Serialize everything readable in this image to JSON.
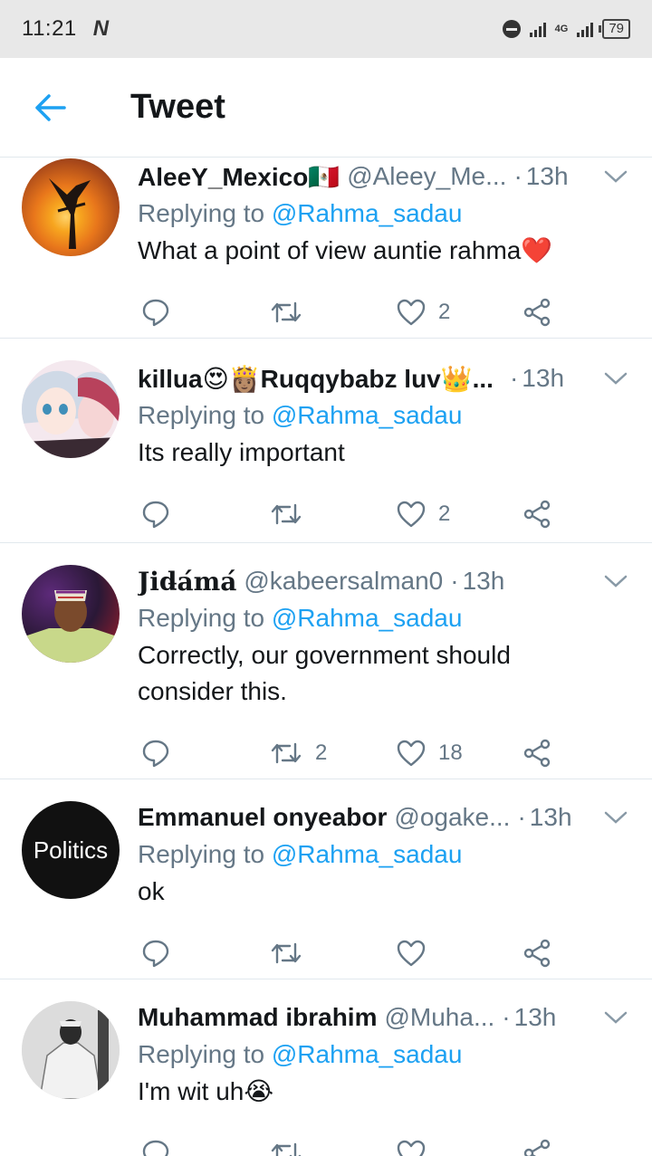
{
  "status_bar": {
    "time": "11:21",
    "carrier_icon": "N",
    "network": "4G",
    "battery": "79"
  },
  "header": {
    "title": "Tweet"
  },
  "tweets": [
    {
      "name": "AleeY_Mexico🇲🇽",
      "handle": "@Aleey_Me...",
      "time": "13h",
      "replying_label": "Replying to",
      "mention": "@Rahma_sadau",
      "text": "What a point of view auntie rahma❤️",
      "retweets": "",
      "likes": "2"
    },
    {
      "name": "killua😍👸🏽Ruqqybabz luv👑...",
      "handle": "",
      "time": "13h",
      "replying_label": "Replying to",
      "mention": "@Rahma_sadau",
      "text": "Its really important",
      "retweets": "",
      "likes": "2"
    },
    {
      "name": "𝐉𝐢𝐝̵𝐚́𝐦𝐚́",
      "handle": "@kabeersalman0",
      "time": "13h",
      "replying_label": "Replying to",
      "mention": "@Rahma_sadau",
      "text": "Correctly, our government should consider this.",
      "retweets": "2",
      "likes": "18"
    },
    {
      "name": "Emmanuel onyeabor",
      "handle": "@ogake...",
      "time": "13h",
      "replying_label": "Replying to",
      "mention": "@Rahma_sadau",
      "text": "ok",
      "retweets": "",
      "likes": "",
      "avatar_text": "Politics"
    },
    {
      "name": "Muhammad ibrahim",
      "handle": "@Muha...",
      "time": "13h",
      "replying_label": "Replying to",
      "mention": "@Rahma_sadau",
      "text": "I'm wit uh😭",
      "retweets": "",
      "likes": ""
    }
  ]
}
